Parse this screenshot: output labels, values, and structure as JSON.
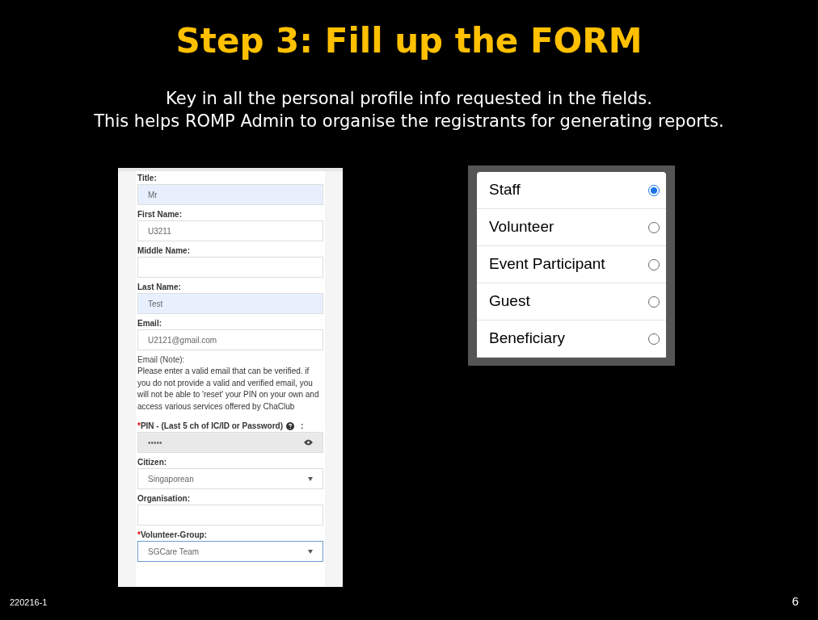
{
  "title": "Step 3: Fill up the FORM",
  "subtitle": [
    "Key in all the personal profile info requested in the fields.",
    "This helps ROMP Admin to organise the registrants for generating reports."
  ],
  "form": {
    "fields": [
      {
        "kind": "text",
        "label": "Title:",
        "value": "Mr",
        "autofilled": true,
        "focused": false
      },
      {
        "kind": "text",
        "label": "First Name:",
        "value": "U3211",
        "autofilled": false,
        "focused": false
      },
      {
        "kind": "text",
        "label": "Middle Name:",
        "autofilled": false,
        "focused": false
      },
      {
        "kind": "text",
        "label": "Last Name:",
        "value": "Test",
        "autofilled": true,
        "focused": false
      },
      {
        "kind": "text",
        "label": "Email:",
        "value": "U2121@gmail.com",
        "autofilled": false,
        "focused": false
      },
      {
        "kind": "note",
        "label": "Email (Note):",
        "text": "Please enter a valid email that can be verified. if you do not provide a valid and verified email, you will not be able to 'reset' your PIN on your own and access various services offered by ChaClub"
      },
      {
        "kind": "password",
        "required_mark": "*",
        "label": "PIN - (Last 5 ch of IC/ID or Password)",
        "suffix": ":",
        "value": "•••••",
        "focused": false
      },
      {
        "kind": "select",
        "label": "Citizen:",
        "value": "Singaporean",
        "autofilled": false,
        "focused": false
      },
      {
        "kind": "text",
        "label": "Organisation:",
        "autofilled": false,
        "focused": false
      },
      {
        "kind": "select",
        "required_mark": "*",
        "label": "Volunteer-Group:",
        "value": "SGCare Team",
        "autofilled": false,
        "focused": true
      }
    ]
  },
  "roles": [
    {
      "label": "Staff",
      "selected": true
    },
    {
      "label": "Volunteer",
      "selected": false
    },
    {
      "label": "Event Participant",
      "selected": false
    },
    {
      "label": "Guest",
      "selected": false
    },
    {
      "label": "Beneficiary",
      "selected": false
    }
  ],
  "footer": {
    "code": "220216-1",
    "page": "6"
  }
}
